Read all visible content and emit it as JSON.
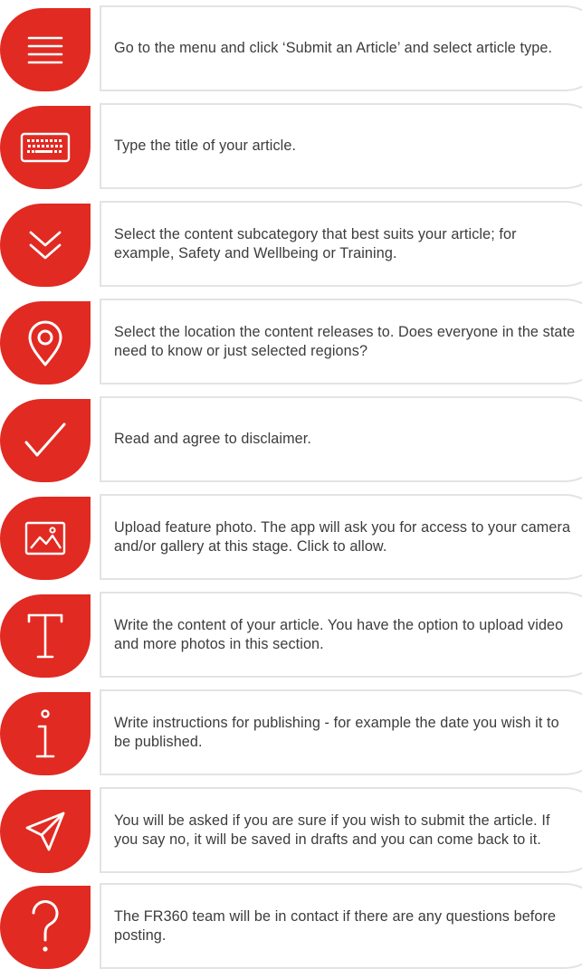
{
  "brand": {
    "accent": "#e12a22",
    "card_border": "#e3e3e3",
    "text_color": "#3c3c3c"
  },
  "steps": [
    {
      "icon": "menu-icon",
      "text": "Go to the menu and click ‘Submit an Article’ and select article type."
    },
    {
      "icon": "keyboard-icon",
      "text": "Type the title of your article."
    },
    {
      "icon": "chevrons-down-icon",
      "text": "Select the content subcategory that best suits your article; for example, Safety and Wellbeing or Training."
    },
    {
      "icon": "location-pin-icon",
      "text": "Select the location the content releases to. Does everyone in the state need to know or just selected regions?"
    },
    {
      "icon": "checkmark-icon",
      "text": "Read and agree to disclaimer."
    },
    {
      "icon": "image-icon",
      "text": "Upload feature photo. The app will ask you for access to your camera and/or gallery at this stage. Click to allow."
    },
    {
      "icon": "text-t-icon",
      "text": "Write the content of your article. You have the option to upload video and more photos in this section."
    },
    {
      "icon": "info-icon",
      "text": "Write instructions for publishing - for example the date you wish it to be published."
    },
    {
      "icon": "send-icon",
      "text": "You will be asked if you are sure if you wish to submit the article. If you say no, it will be saved in drafts and you can come back to it."
    },
    {
      "icon": "question-icon",
      "text": "The FR360 team will be in contact if there are any questions before posting."
    }
  ]
}
